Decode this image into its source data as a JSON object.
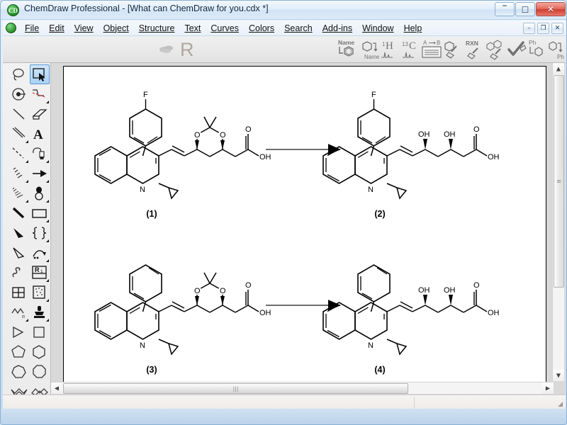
{
  "window": {
    "title": "ChemDraw Professional - [What can ChemDraw for you.cdx *]",
    "app_icon": "chemdraw-logo-icon",
    "minimize_label": "–",
    "maximize_label": "□",
    "close_label": "✕"
  },
  "menubar": {
    "items": [
      {
        "label": "File"
      },
      {
        "label": "Edit"
      },
      {
        "label": "View"
      },
      {
        "label": "Object"
      },
      {
        "label": "Structure"
      },
      {
        "label": "Text"
      },
      {
        "label": "Curves"
      },
      {
        "label": "Colors"
      },
      {
        "label": "Search"
      },
      {
        "label": "Add-ins"
      },
      {
        "label": "Window"
      },
      {
        "label": "Help"
      }
    ],
    "mdi_minimize": "–",
    "mdi_restore": "❐",
    "mdi_close": "✕"
  },
  "toolbar": {
    "logo_letter": "R",
    "buttons": [
      {
        "name": "name-to-structure",
        "label": "Name",
        "sub": ""
      },
      {
        "name": "structure-to-name",
        "label": "",
        "sub": "Name"
      },
      {
        "name": "predict-1h-nmr",
        "label": "1H",
        "sub": ""
      },
      {
        "name": "predict-13c-nmr",
        "label": "13C",
        "sub": ""
      },
      {
        "name": "structure-to-properties",
        "label": "A → B",
        "sub": ""
      },
      {
        "name": "clean-up-structure",
        "label": "",
        "sub": ""
      },
      {
        "name": "clean-up-reaction",
        "label": "RXN",
        "sub": ""
      },
      {
        "name": "clean-up-multiple-structures",
        "label": "",
        "sub": ""
      },
      {
        "name": "check-structure",
        "label": "",
        "sub": ""
      },
      {
        "name": "expand-label",
        "label": "Ph",
        "sub": ""
      },
      {
        "name": "contract-label",
        "label": "",
        "sub": "Ph"
      }
    ]
  },
  "toolbox": {
    "selected_tool": "marquee-select",
    "tools": [
      {
        "name": "lasso-select-tool",
        "has_submenu": false
      },
      {
        "name": "marquee-select-tool",
        "has_submenu": false,
        "selected": true
      },
      {
        "name": "eraser-target-tool",
        "has_submenu": false
      },
      {
        "name": "dashed-chain-tool",
        "has_submenu": true
      },
      {
        "name": "solid-bond-tool",
        "has_submenu": false
      },
      {
        "name": "eraser-tool",
        "has_submenu": false
      },
      {
        "name": "multiple-bond-tool",
        "has_submenu": true
      },
      {
        "name": "text-tool",
        "has_submenu": false
      },
      {
        "name": "dashed-bond-tool",
        "has_submenu": true
      },
      {
        "name": "pen-tool",
        "has_submenu": true
      },
      {
        "name": "hashed-bond-tool",
        "has_submenu": true
      },
      {
        "name": "arrow-tool",
        "has_submenu": true
      },
      {
        "name": "hashed-wedge-tool",
        "has_submenu": true
      },
      {
        "name": "orbital-tool",
        "has_submenu": true
      },
      {
        "name": "bold-bond-tool",
        "has_submenu": false
      },
      {
        "name": "rectangle-tool",
        "has_submenu": true
      },
      {
        "name": "wedge-bond-tool",
        "has_submenu": false
      },
      {
        "name": "bracket-tool",
        "has_submenu": true
      },
      {
        "name": "hollow-wedge-tool",
        "has_submenu": false
      },
      {
        "name": "arc-arrow-tool",
        "has_submenu": true
      },
      {
        "name": "squiggle-bond-tool",
        "has_submenu": false
      },
      {
        "name": "r-group-tool",
        "has_submenu": true
      },
      {
        "name": "table-tool",
        "has_submenu": false
      },
      {
        "name": "selection-box-tool",
        "has_submenu": true
      },
      {
        "name": "chain-tool",
        "has_submenu": true
      },
      {
        "name": "stamp-tool",
        "has_submenu": true
      },
      {
        "name": "cyclopropane-tool",
        "has_submenu": false
      },
      {
        "name": "cyclobutane-tool",
        "has_submenu": false
      },
      {
        "name": "cyclopentane-tool",
        "has_submenu": false
      },
      {
        "name": "cyclohexane-tool",
        "has_submenu": false
      },
      {
        "name": "cycloheptane-tool",
        "has_submenu": false
      },
      {
        "name": "cyclooctane-tool",
        "has_submenu": false
      },
      {
        "name": "chair-ring-tool",
        "has_submenu": false
      },
      {
        "name": "chair-ring-alt-tool",
        "has_submenu": false
      },
      {
        "name": "cyclopentadiene-tool",
        "has_submenu": false
      },
      {
        "name": "benzene-tool",
        "has_submenu": false
      }
    ]
  },
  "document": {
    "structures": [
      {
        "id": "structure-1",
        "label": "(1)",
        "aryl_substituent": "F",
        "heteroatom_labels": [
          "F",
          "N",
          "O",
          "O",
          "O",
          "OH"
        ],
        "description": "pitavastatin acetonide, 4-fluorophenyl"
      },
      {
        "id": "structure-2",
        "label": "(2)",
        "aryl_substituent": "F",
        "heteroatom_labels": [
          "F",
          "N",
          "OH",
          "OH",
          "O",
          "OH"
        ],
        "description": "pitavastatin free diol, 4-fluorophenyl"
      },
      {
        "id": "structure-3",
        "label": "(3)",
        "aryl_substituent": "",
        "heteroatom_labels": [
          "N",
          "O",
          "O",
          "O",
          "OH"
        ],
        "description": "des-fluoro pitavastatin acetonide, phenyl"
      },
      {
        "id": "structure-4",
        "label": "(4)",
        "aryl_substituent": "",
        "heteroatom_labels": [
          "N",
          "OH",
          "OH",
          "O",
          "OH"
        ],
        "description": "des-fluoro pitavastatin free diol, phenyl"
      }
    ],
    "arrows": [
      {
        "name": "reaction-arrow-top"
      },
      {
        "name": "reaction-arrow-bottom"
      }
    ]
  },
  "scrollbars": {
    "vertical_up": "▲",
    "vertical_down": "▼",
    "horizontal_left": "◀",
    "horizontal_right": "▶",
    "grip_glyph": "⦀"
  },
  "statusbar": {
    "text": ""
  },
  "colors": {
    "accent": "#5a9ad4",
    "titlebar_text": "#0b2540",
    "canvas": "#ffffff",
    "desk": "#d9d9d9",
    "structure_ink": "#000000",
    "arrow": "#6e6e6e",
    "toolbar_logo": "#b0a89c"
  }
}
